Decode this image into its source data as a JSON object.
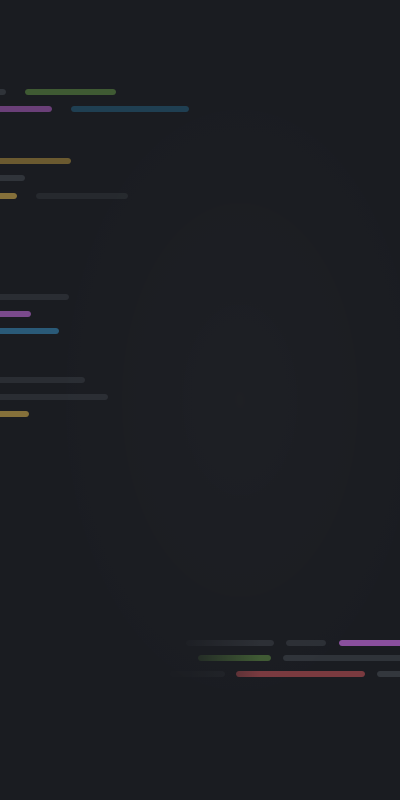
{
  "screen": {
    "description_name": "blurred-code-background",
    "background_color": "#1a1c21"
  },
  "palette": {
    "gray": "#2f3339",
    "gray_light": "#3a3e45",
    "green": "#3f5a33",
    "purple": "#6a3f78",
    "purple_bright": "#8a4f9e",
    "blue": "#1f3f52",
    "blue_bright": "#2a5a78",
    "olive": "#6b5a30",
    "gold": "#85703a",
    "red": "#7a3a3f"
  },
  "code_blocks": [
    {
      "name": "code-block-top",
      "lines": 4
    },
    {
      "name": "code-block-middle",
      "lines": 3
    },
    {
      "name": "code-block-lower",
      "lines": 3
    },
    {
      "name": "code-block-bottom-right",
      "lines": 3
    }
  ]
}
